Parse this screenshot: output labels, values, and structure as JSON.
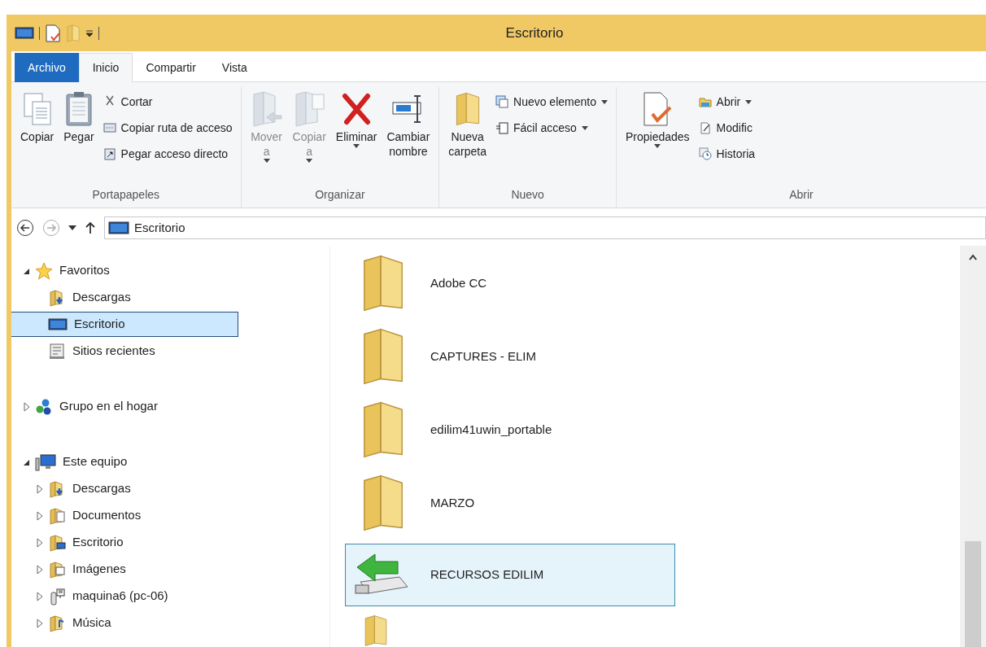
{
  "window": {
    "title": "Escritorio"
  },
  "tabs": [
    {
      "label": "Archivo",
      "kind": "file",
      "selected": false
    },
    {
      "label": "Inicio",
      "kind": "tab",
      "selected": true
    },
    {
      "label": "Compartir",
      "kind": "tab",
      "selected": false
    },
    {
      "label": "Vista",
      "kind": "tab",
      "selected": false
    }
  ],
  "ribbon": [
    {
      "label": "Portapapeles",
      "large": [
        {
          "label": "Copiar",
          "kind": "copy",
          "disabled": false,
          "dropdown": false
        },
        {
          "label": "Pegar",
          "kind": "paste",
          "disabled": false,
          "dropdown": false
        }
      ],
      "small": [
        {
          "label": "Cortar",
          "kind": "cut",
          "dropdown": false
        },
        {
          "label": "Copiar ruta de acceso",
          "kind": "path",
          "dropdown": false
        },
        {
          "label": "Pegar acceso directo",
          "kind": "shortcut",
          "dropdown": false
        }
      ]
    },
    {
      "label": "Organizar",
      "large": [
        {
          "label": "Mover\na",
          "kind": "move",
          "disabled": true,
          "dropdown": true
        },
        {
          "label": "Copiar\na",
          "kind": "copyto",
          "disabled": true,
          "dropdown": true
        },
        {
          "label": "Eliminar",
          "kind": "delete",
          "disabled": false,
          "dropdown": true
        },
        {
          "label": "Cambiar\nnombre",
          "kind": "rename",
          "disabled": false,
          "dropdown": false
        }
      ]
    },
    {
      "label": "Nuevo",
      "large": [
        {
          "label": "Nueva\ncarpeta",
          "kind": "folder",
          "disabled": false,
          "dropdown": false
        }
      ],
      "small": [
        {
          "label": "Nuevo elemento",
          "kind": "newitem",
          "dropdown": true
        },
        {
          "label": "Fácil acceso",
          "kind": "easy",
          "dropdown": true
        }
      ]
    },
    {
      "label": "Abrir",
      "large": [
        {
          "label": "Propiedades",
          "kind": "props",
          "disabled": false,
          "dropdown": true
        }
      ],
      "small": [
        {
          "label": "Abrir",
          "kind": "open",
          "dropdown": true
        },
        {
          "label": "Modific",
          "kind": "edit",
          "dropdown": false
        },
        {
          "label": "Historia",
          "kind": "history",
          "dropdown": false
        }
      ]
    }
  ],
  "address": {
    "path": "Escritorio"
  },
  "nav": [
    {
      "label": "Favoritos",
      "kind": "star",
      "expanded": true,
      "selected": false,
      "children": [
        {
          "label": "Descargas",
          "kind": "downloads",
          "selected": false
        },
        {
          "label": "Escritorio",
          "kind": "desktop",
          "selected": true
        },
        {
          "label": "Sitios recientes",
          "kind": "recent",
          "selected": false
        }
      ]
    },
    {
      "label": "Grupo en el hogar",
      "kind": "homegroup",
      "expanded": false,
      "selected": false
    },
    {
      "label": "Este equipo",
      "kind": "pc",
      "expanded": true,
      "selected": false,
      "children": [
        {
          "label": "Descargas",
          "kind": "downloads",
          "expanded": false,
          "selected": false
        },
        {
          "label": "Documentos",
          "kind": "docs",
          "expanded": false,
          "selected": false
        },
        {
          "label": "Escritorio",
          "kind": "desktopfolder",
          "expanded": false,
          "selected": false
        },
        {
          "label": "Imágenes",
          "kind": "pictures",
          "expanded": false,
          "selected": false
        },
        {
          "label": "maquina6 (pc-06)",
          "kind": "network",
          "expanded": false,
          "selected": false
        },
        {
          "label": "Música",
          "kind": "music",
          "expanded": false,
          "selected": false
        }
      ]
    }
  ],
  "files": [
    {
      "name": "Adobe CC",
      "kind": "folder",
      "selected": false
    },
    {
      "name": "CAPTURES - ELIM",
      "kind": "folder",
      "selected": false
    },
    {
      "name": "edilim41uwin_portable",
      "kind": "folder",
      "selected": false
    },
    {
      "name": "MARZO",
      "kind": "folder",
      "selected": false
    },
    {
      "name": "RECURSOS EDILIM",
      "kind": "drive",
      "selected": true
    }
  ]
}
